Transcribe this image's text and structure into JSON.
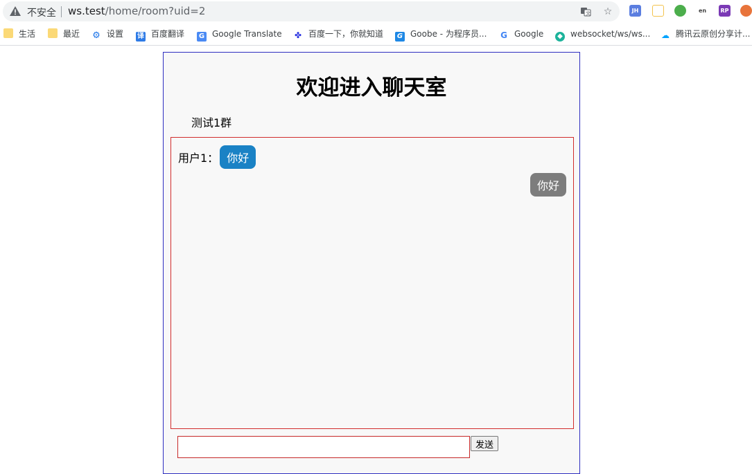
{
  "browser": {
    "security_label": "不安全",
    "url_host": "ws.test",
    "url_path": "/home/room?uid=2",
    "extensions": [
      {
        "name": "JH",
        "color": "#5b7ee0"
      },
      {
        "name": "",
        "color": "#f3c34d"
      },
      {
        "name": "",
        "color": "#4cae4c"
      },
      {
        "name": "en",
        "color": "#444444"
      },
      {
        "name": "RP",
        "color": "#7b3ab5"
      },
      {
        "name": "",
        "color": "#e8743b"
      }
    ]
  },
  "bookmarks": [
    {
      "label": "生活",
      "icon": "folder-icon"
    },
    {
      "label": "最近",
      "icon": "folder-icon"
    },
    {
      "label": "设置",
      "icon": "gear-icon"
    },
    {
      "label": "百度翻译",
      "icon": "translate-icon"
    },
    {
      "label": "Google Translate",
      "icon": "google-translate-icon"
    },
    {
      "label": "百度一下，你就知道",
      "icon": "baidu-icon"
    },
    {
      "label": "Goobe - 为程序员...",
      "icon": "goobe-icon"
    },
    {
      "label": "Google",
      "icon": "google-icon"
    },
    {
      "label": "websocket/ws/ws...",
      "icon": "websocket-icon"
    },
    {
      "label": "腾讯云原创分享计...",
      "icon": "cloud-icon"
    }
  ],
  "page": {
    "title": "欢迎进入聊天室",
    "group_name": "测试1群",
    "messages": {
      "incoming_sender": "用户1：",
      "incoming_text": "你好",
      "outgoing_text": "你好"
    },
    "input_value": "",
    "send_label": "发送"
  },
  "colors": {
    "incoming_bubble": "#1a82c5",
    "outgoing_bubble": "#7d7d7d",
    "chatbox_border": "#d12b2b",
    "container_border": "#2c2cbf"
  }
}
